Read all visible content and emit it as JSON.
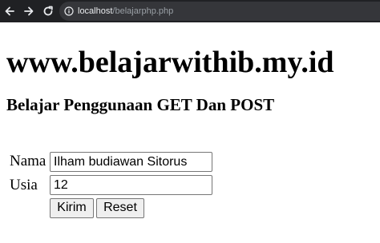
{
  "browser": {
    "url_host": "localhost",
    "url_path": "/belajarphp.php",
    "icons": {
      "back": "arrow-left-icon",
      "forward": "arrow-right-icon",
      "reload": "reload-icon",
      "info": "info-icon"
    }
  },
  "page": {
    "site_title": "www.belajarwithib.my.id",
    "subtitle": "Belajar Penggunaan GET Dan POST"
  },
  "form": {
    "nama_label": "Nama",
    "nama_value": "Ilham budiawan Sitorus",
    "usia_label": "Usia",
    "usia_value": "12",
    "submit_label": "Kirim",
    "reset_label": "Reset"
  },
  "colors": {
    "toolbar_bg": "#202124",
    "omnibox_bg": "#35363a",
    "url_host": "#e8eaed",
    "url_path": "#9aa0a6"
  }
}
